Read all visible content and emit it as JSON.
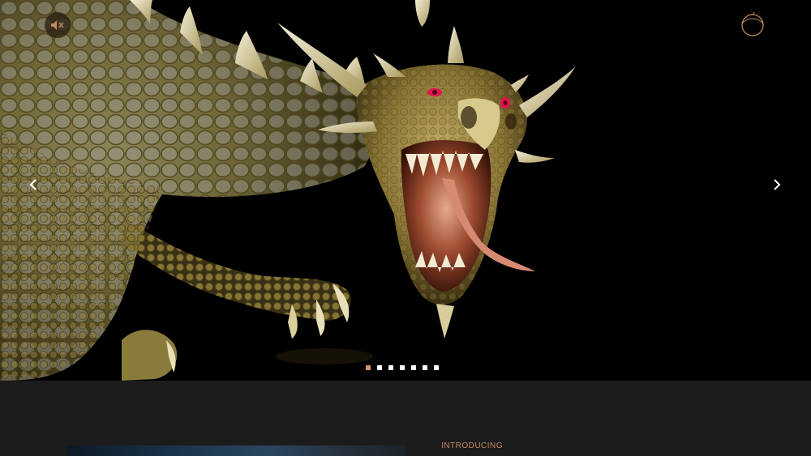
{
  "hero": {
    "controls": {
      "mute_icon": "speaker-muted-icon",
      "prev_icon": "chevron-left-icon",
      "next_icon": "chevron-right-icon"
    },
    "slide_indicators": {
      "total": 7,
      "active_index": 0,
      "active_color": "#d4956b",
      "inactive_color": "#ffffff"
    },
    "logo_icon": "brand-orbit-logo",
    "accent_color": "#c08a5a"
  },
  "intro_section": {
    "label": "INTRODUCING"
  }
}
